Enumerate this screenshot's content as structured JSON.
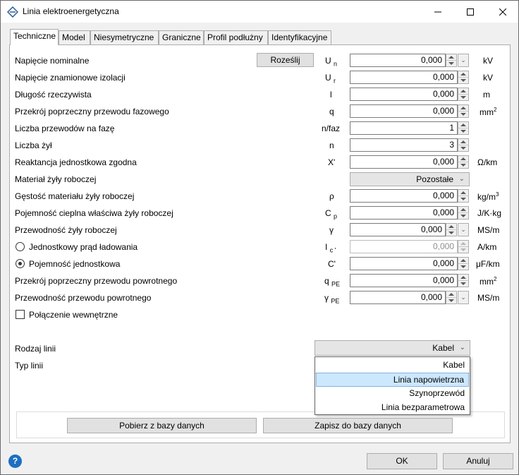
{
  "window": {
    "title": "Linia elektroenergetyczna",
    "icon": "diamond-line-icon"
  },
  "tabs": [
    "Techniczne",
    "Model",
    "Niesymetryczne",
    "Graniczne",
    "Profil podłużny",
    "Identyfikacyjne"
  ],
  "rows": {
    "napiecie_nominalne": {
      "label": "Napięcie nominalne",
      "button": "Roześlij",
      "sym": "U",
      "sub": "n",
      "value": "0,000",
      "unit": "kV"
    },
    "napiecie_izolacji": {
      "label": "Napięcie znamionowe izolacji",
      "sym": "U",
      "sub": "r",
      "value": "0,000",
      "unit": "kV"
    },
    "dlugosc": {
      "label": "Długość rzeczywista",
      "sym": "l",
      "value": "0,000",
      "unit": "m"
    },
    "przekroj_fazowy": {
      "label": "Przekrój poprzeczny przewodu fazowego",
      "sym": "q",
      "value": "0,000",
      "unit": "mm",
      "unit_sup": "2"
    },
    "liczba_przewodow": {
      "label": "Liczba przewodów na fazę",
      "sym": "n/faz",
      "value": "1"
    },
    "liczba_zyl": {
      "label": "Liczba żył",
      "sym": "n",
      "value": "3"
    },
    "reaktancja": {
      "label": "Reaktancja jednostkowa zgodna",
      "sym": "X'",
      "value": "0,000",
      "unit": "Ω/km"
    },
    "material": {
      "label": "Materiał żyły roboczej",
      "value": "Pozostałe"
    },
    "gestosc": {
      "label": "Gęstość materiału żyły roboczej",
      "sym": "ρ",
      "value": "0,000",
      "unit": "kg/m",
      "unit_sup": "3"
    },
    "pojemnosc_cieplna": {
      "label": "Pojemność cieplna właściwa żyły roboczej",
      "sym": "C",
      "sub": "p",
      "value": "0,000",
      "unit": "J/K·kg"
    },
    "przewodnosc": {
      "label": "Przewodność żyły roboczej",
      "sym": "γ",
      "value": "0,000",
      "unit": "MS/m"
    },
    "prad_ladowania": {
      "label": "Jednostkowy prąd ładowania",
      "sym": "I",
      "sub": "c '",
      "value": "0,000",
      "unit": "A/km"
    },
    "pojemnosc": {
      "label": "Pojemność jednostkowa",
      "sym": "C'",
      "value": "0,000",
      "unit": "μF/km"
    },
    "przekroj_powrotny": {
      "label": "Przekrój poprzeczny przewodu powrotnego",
      "sym": "q",
      "sub": "PE",
      "value": "0,000",
      "unit": "mm",
      "unit_sup": "2"
    },
    "przewodnosc_powrotna": {
      "label": "Przewodność przewodu powrotnego",
      "sym": "γ",
      "sub": "PE",
      "value": "0,000",
      "unit": "MS/m"
    },
    "polaczenie": {
      "label": "Połączenie wewnętrzne"
    },
    "rodzaj_linii": {
      "label": "Rodzaj linii",
      "value": "Kabel"
    },
    "typ_linii": {
      "label": "Typ linii"
    }
  },
  "dropdown_options": [
    "Kabel",
    "Linia napowietrzna",
    "Szynoprzewód",
    "Linia bezparametrowa"
  ],
  "database": {
    "fetch": "Pobierz z bazy danych",
    "save": "Zapisz do bazy danych"
  },
  "footer": {
    "ok": "OK",
    "cancel": "Anuluj",
    "help": "?"
  },
  "colors": {
    "accent": "#1d6ec2",
    "selection": "#cce8ff"
  }
}
